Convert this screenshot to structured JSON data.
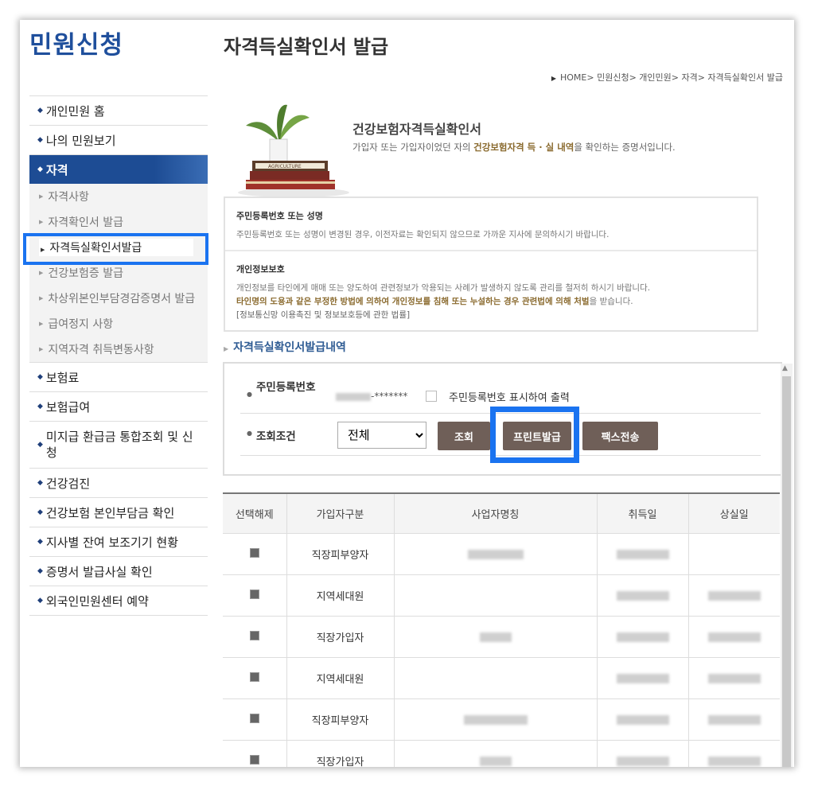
{
  "header": {
    "brand": "민원신청",
    "page_title": "자격득실확인서 발급",
    "breadcrumb": "HOME> 민원신청> 개인민원> 자격> 자격득실확인서 발급"
  },
  "sidebar": {
    "items_top": [
      {
        "label": "개인민원 홈"
      },
      {
        "label": "나의 민원보기"
      },
      {
        "label": "자격"
      }
    ],
    "sub_items": [
      {
        "label": "자격사항"
      },
      {
        "label": "자격확인서 발급"
      },
      {
        "label": "자격득실확인서발급"
      },
      {
        "label": "건강보험증 발급"
      },
      {
        "label": "차상위본인부담경감증명서 발급"
      },
      {
        "label": "급여정지 사항"
      },
      {
        "label": "지역자격 취득변동사항"
      }
    ],
    "items_bottom": [
      {
        "label": "보험료"
      },
      {
        "label": "보험급여"
      },
      {
        "label": "미지급 환급금 통합조회 및 신청"
      },
      {
        "label": "건강검진"
      },
      {
        "label": "건강보험 본인부담금 확인"
      },
      {
        "label": "지사별 잔여 보조기기 현황"
      },
      {
        "label": "증명서 발급사실 확인"
      },
      {
        "label": "외국인민원센터 예약"
      }
    ]
  },
  "intro": {
    "title": "건강보험자격득실확인서",
    "desc_pre": "가입자 또는 가입자이었던 자의 ",
    "desc_em": "건강보험자격 득 · 실 내역",
    "desc_post": "을 확인하는 증명서입니다.",
    "book_label": "AGRICULTURE"
  },
  "notice": {
    "sec1_title": "주민등록번호 또는 성명",
    "sec1_text": "주민등록번호 또는 성명이 변경된 경우, 이전자료는 확인되지 않으므로 가까운 지사에 문의하시기 바랍니다.",
    "sec2_title": "개인정보보호",
    "sec2_text": "개인정보를 타인에게 매매 또는 양도하여 관련정보가 악용되는 사례가 발생하지 않도록 관리를 철저히 하시기 바랍니다.",
    "sec2_warn": "타인명의 도용과 같은 부정한 방법에 의하여 개인정보를 침해 또는 누설하는 경우 관련법에 의해 처벌",
    "sec2_warn_post": "을 받습니다.",
    "sec2_law": "[정보통신망 이용촉진 및 정보보호등에 관한 법률]"
  },
  "section_title": "자격득실확인서발급내역",
  "search": {
    "rrn_label": "주민등록번호",
    "rrn_masked": "-*******",
    "show_rrn_label": "주민등록번호 표시하여 출력",
    "cond_label": "조회조건",
    "cond_value": "전체",
    "btn_search": "조회",
    "btn_print": "프린트발급",
    "btn_fax": "팩스전송"
  },
  "table": {
    "headers": [
      "선택해제",
      "가입자구분",
      "사업자명칭",
      "취득일",
      "상실일"
    ],
    "rows": [
      {
        "type": "직장피부양자",
        "has_biz": true,
        "has_lost": false
      },
      {
        "type": "지역세대원",
        "has_biz": false,
        "has_lost": true
      },
      {
        "type": "직장가입자",
        "has_biz": true,
        "has_lost": true
      },
      {
        "type": "지역세대원",
        "has_biz": false,
        "has_lost": true
      },
      {
        "type": "직장피부양자",
        "has_biz": true,
        "has_lost": true
      },
      {
        "type": "직장가입자",
        "has_biz": true,
        "has_lost": true
      }
    ]
  }
}
